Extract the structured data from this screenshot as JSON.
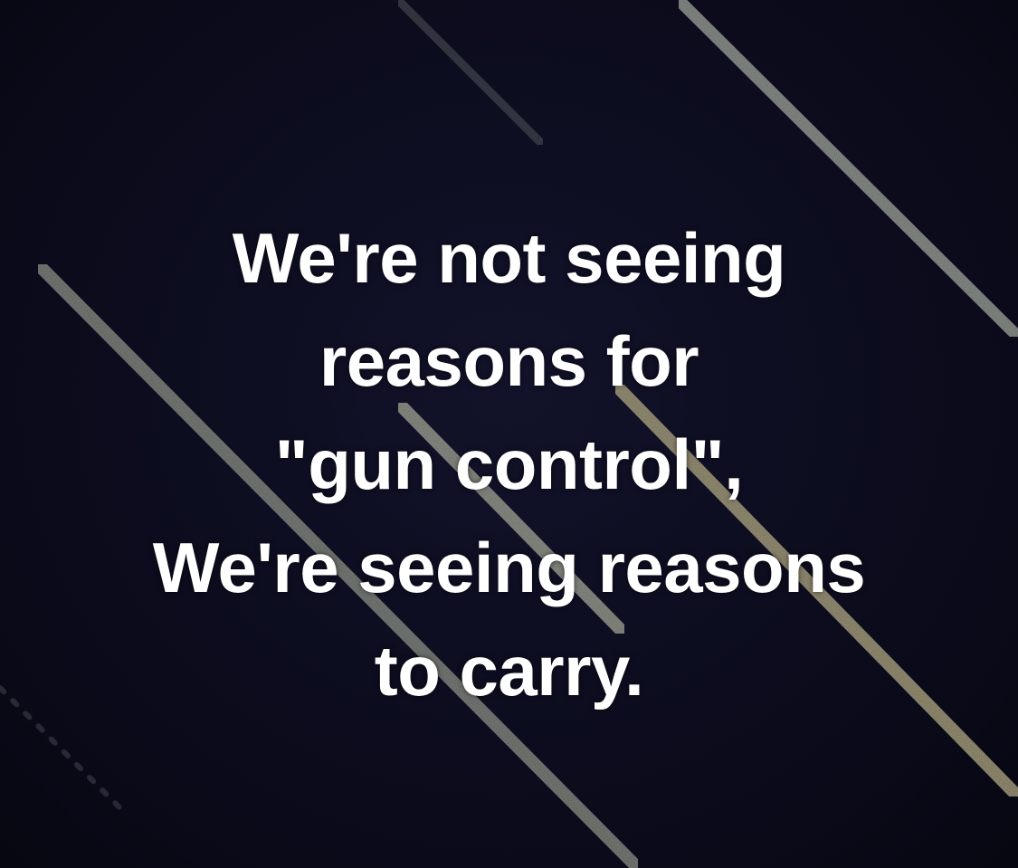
{
  "background": {
    "base_color": "#0b0b1a",
    "streak_colors": [
      "#8a8f86",
      "#9ca39a",
      "#b9b08a",
      "#6f746e"
    ]
  },
  "quote": {
    "lines": [
      "We're not seeing",
      "reasons for",
      "\"gun control\",",
      "We're seeing reasons",
      "to carry."
    ]
  }
}
